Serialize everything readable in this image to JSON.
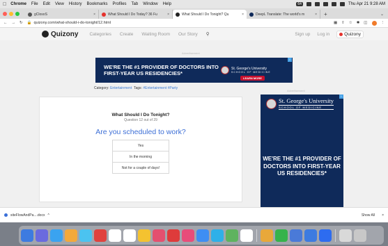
{
  "menubar": {
    "app": "Chrome",
    "items": [
      "File",
      "Edit",
      "View",
      "History",
      "Bookmarks",
      "Profiles",
      "Tab",
      "Window",
      "Help"
    ],
    "battery": "64",
    "clock": "Thu Apr 21 9:28 AM"
  },
  "tabs": [
    {
      "title": "gClosoS",
      "active": false
    },
    {
      "title": "What Should I Do Today? 36 Fu",
      "active": false
    },
    {
      "title": "What Should I Do Tonight? Qu",
      "active": true
    },
    {
      "title": "DeepL Translate: The world's m",
      "active": false
    }
  ],
  "address": {
    "url": "quizony.com/what-should-i-do-tonight/12.html"
  },
  "site": {
    "logo": "Quizony",
    "nav": [
      "Categories",
      "Create",
      "Waiting Room",
      "Our Story"
    ],
    "signup": "Sign up",
    "login": "Log in",
    "badge": "Quizony"
  },
  "ads": {
    "label": "Advertisement",
    "banner_text": "WE'RE THE #1 PROVIDER OF DOCTORS INTO FIRST-YEAR US RESIDENCIES*",
    "university": "St. George's University",
    "school": "SCHOOL OF MEDICINE",
    "learn_more": "LEARN MORE",
    "side_text": "WE'RE THE #1 PROVIDER OF DOCTORS INTO FIRST-YEAR US RESIDENCIES*"
  },
  "category_line": {
    "category_label": "Category:",
    "category": "Entertainment",
    "tags_label": "Tags:",
    "tags": "#Entertainment #Party"
  },
  "quiz": {
    "title": "What Should I Do Tonight?",
    "progress": "Question 12 out of 29",
    "question": "Are you scheduled to work?",
    "answers": [
      "Yes",
      "In the morning",
      "Not for a couple of days!"
    ]
  },
  "download": {
    "file": "siteFlowAndPa....docx",
    "show_all": "Show All"
  },
  "dock": {
    "colors": [
      "#3d7be0",
      "#6a6adf",
      "#3aa3f0",
      "#f3a93b",
      "#4bc3f0",
      "#e0423e",
      "#ffffff",
      "#ffffff",
      "#f4c230",
      "#e44f6f",
      "#de3b3b",
      "#e84c7a",
      "#3e8ef3",
      "#2fb0e8",
      "#5fb35f",
      "#ffffff",
      "#e8a83a",
      "#36b34b",
      "#4a7ad8",
      "#3d7be0",
      "#2d6cf0",
      "#d9d9d9",
      "#c8c8c8"
    ]
  }
}
